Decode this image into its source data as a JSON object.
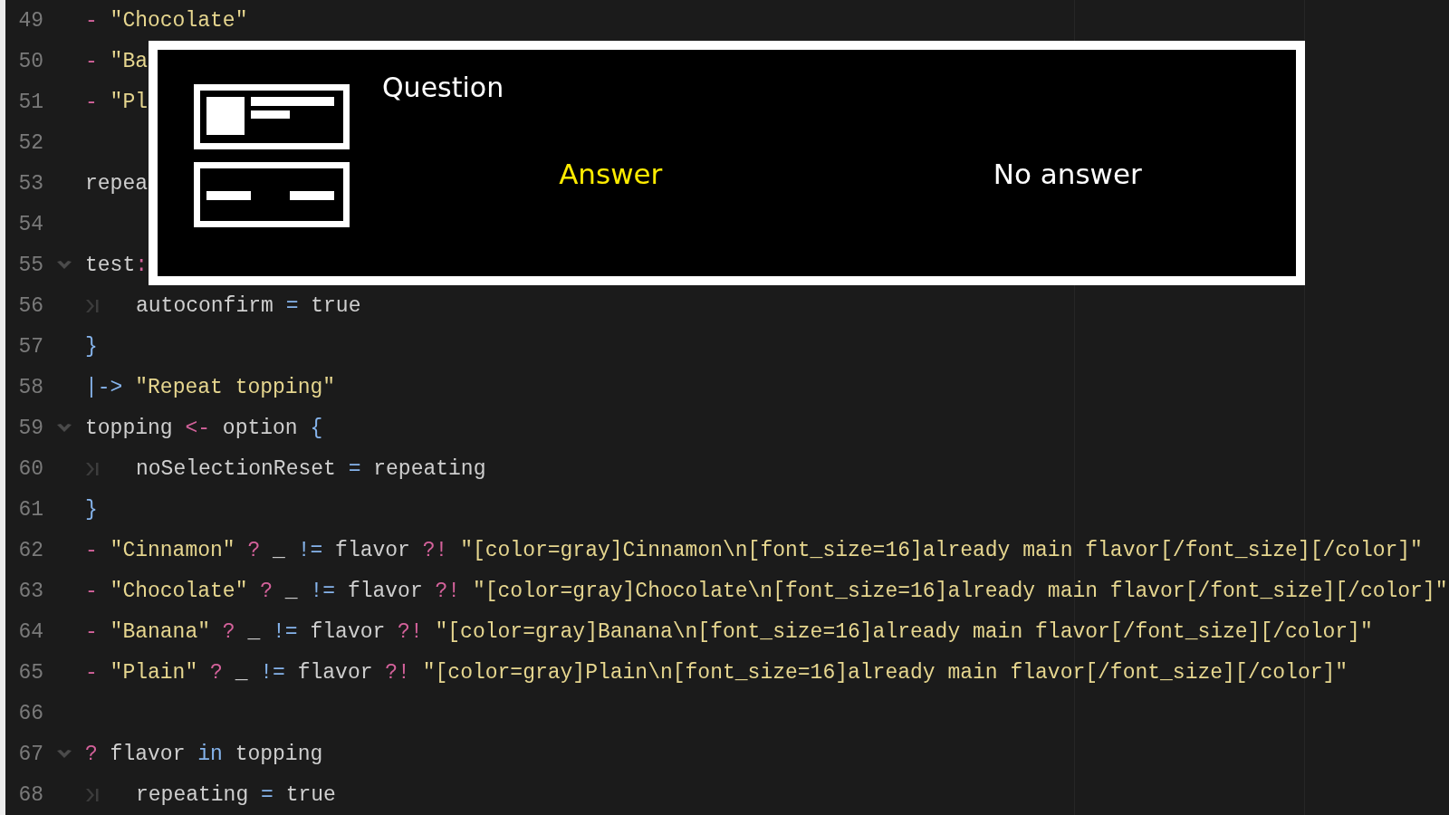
{
  "editor": {
    "lines": [
      {
        "number": "49",
        "foldable": false,
        "indent_guide": false,
        "tokens": [
          {
            "kind": "op",
            "text": "- "
          },
          {
            "kind": "str",
            "text": "\"Chocolate\""
          }
        ]
      },
      {
        "number": "50",
        "foldable": false,
        "indent_guide": false,
        "tokens": [
          {
            "kind": "op",
            "text": "- "
          },
          {
            "kind": "str",
            "text": "\"Ba"
          }
        ]
      },
      {
        "number": "51",
        "foldable": false,
        "indent_guide": false,
        "tokens": [
          {
            "kind": "op",
            "text": "- "
          },
          {
            "kind": "str",
            "text": "\"Pl"
          }
        ]
      },
      {
        "number": "52",
        "foldable": false,
        "indent_guide": false
      },
      {
        "number": "53",
        "foldable": false,
        "indent_guide": false,
        "tokens": [
          {
            "kind": "plain",
            "text": "repea"
          }
        ]
      },
      {
        "number": "54",
        "foldable": false,
        "indent_guide": false
      },
      {
        "number": "55",
        "foldable": true,
        "indent_guide": false,
        "tokens": [
          {
            "kind": "plain",
            "text": "test"
          },
          {
            "kind": "op",
            "text": ":"
          }
        ]
      },
      {
        "number": "56",
        "foldable": false,
        "indent_guide": true,
        "tokens": [
          {
            "kind": "plain",
            "text": "autoconfirm "
          },
          {
            "kind": "kw",
            "text": "="
          },
          {
            "kind": "plain",
            "text": " true"
          }
        ]
      },
      {
        "number": "57",
        "foldable": false,
        "indent_guide": false,
        "tokens": [
          {
            "kind": "kw",
            "text": "}"
          }
        ]
      },
      {
        "number": "58",
        "foldable": false,
        "indent_guide": false,
        "tokens": [
          {
            "kind": "kw",
            "text": "|-> "
          },
          {
            "kind": "str",
            "text": "\"Repeat topping\""
          }
        ]
      },
      {
        "number": "59",
        "foldable": true,
        "indent_guide": false,
        "tokens": [
          {
            "kind": "plain",
            "text": "topping "
          },
          {
            "kind": "op",
            "text": "<-"
          },
          {
            "kind": "plain",
            "text": " option "
          },
          {
            "kind": "kw",
            "text": "{"
          }
        ]
      },
      {
        "number": "60",
        "foldable": false,
        "indent_guide": true,
        "tokens": [
          {
            "kind": "plain",
            "text": "noSelectionReset "
          },
          {
            "kind": "kw",
            "text": "="
          },
          {
            "kind": "plain",
            "text": " repeating"
          }
        ]
      },
      {
        "number": "61",
        "foldable": false,
        "indent_guide": false,
        "tokens": [
          {
            "kind": "kw",
            "text": "}"
          }
        ]
      },
      {
        "number": "62",
        "foldable": false,
        "indent_guide": false,
        "tokens": [
          {
            "kind": "op",
            "text": "- "
          },
          {
            "kind": "str",
            "text": "\"Cinnamon\""
          },
          {
            "kind": "op",
            "text": " ? "
          },
          {
            "kind": "plain",
            "text": "_ "
          },
          {
            "kind": "kw",
            "text": "!="
          },
          {
            "kind": "plain",
            "text": " flavor "
          },
          {
            "kind": "op",
            "text": "?! "
          },
          {
            "kind": "str",
            "text": "\"[color=gray]Cinnamon\\n[font_size=16]already main flavor[/font_size][/color]\""
          }
        ]
      },
      {
        "number": "63",
        "foldable": false,
        "indent_guide": false,
        "tokens": [
          {
            "kind": "op",
            "text": "- "
          },
          {
            "kind": "str",
            "text": "\"Chocolate\""
          },
          {
            "kind": "op",
            "text": " ? "
          },
          {
            "kind": "plain",
            "text": "_ "
          },
          {
            "kind": "kw",
            "text": "!="
          },
          {
            "kind": "plain",
            "text": " flavor "
          },
          {
            "kind": "op",
            "text": "?! "
          },
          {
            "kind": "str",
            "text": "\"[color=gray]Chocolate\\n[font_size=16]already main flavor[/font_size][/color]\""
          }
        ]
      },
      {
        "number": "64",
        "foldable": false,
        "indent_guide": false,
        "tokens": [
          {
            "kind": "op",
            "text": "- "
          },
          {
            "kind": "str",
            "text": "\"Banana\""
          },
          {
            "kind": "op",
            "text": " ? "
          },
          {
            "kind": "plain",
            "text": "_ "
          },
          {
            "kind": "kw",
            "text": "!="
          },
          {
            "kind": "plain",
            "text": " flavor "
          },
          {
            "kind": "op",
            "text": "?! "
          },
          {
            "kind": "str",
            "text": "\"[color=gray]Banana\\n[font_size=16]already main flavor[/font_size][/color]\""
          }
        ]
      },
      {
        "number": "65",
        "foldable": false,
        "indent_guide": false,
        "tokens": [
          {
            "kind": "op",
            "text": "- "
          },
          {
            "kind": "str",
            "text": "\"Plain\""
          },
          {
            "kind": "op",
            "text": " ? "
          },
          {
            "kind": "plain",
            "text": "_ "
          },
          {
            "kind": "kw",
            "text": "!="
          },
          {
            "kind": "plain",
            "text": " flavor "
          },
          {
            "kind": "op",
            "text": "?! "
          },
          {
            "kind": "str",
            "text": "\"[color=gray]Plain\\n[font_size=16]already main flavor[/font_size][/color]\""
          }
        ]
      },
      {
        "number": "66",
        "foldable": false,
        "indent_guide": false
      },
      {
        "number": "67",
        "foldable": true,
        "indent_guide": false,
        "tokens": [
          {
            "kind": "op",
            "text": "?"
          },
          {
            "kind": "plain",
            "text": " flavor "
          },
          {
            "kind": "kw",
            "text": "in"
          },
          {
            "kind": "plain",
            "text": " topping"
          }
        ]
      },
      {
        "number": "68",
        "foldable": false,
        "indent_guide": true,
        "tokens": [
          {
            "kind": "plain",
            "text": "repeating "
          },
          {
            "kind": "kw",
            "text": "="
          },
          {
            "kind": "plain",
            "text": " true"
          }
        ]
      }
    ]
  },
  "dialog": {
    "title": "Question",
    "options": [
      {
        "label": "Answer",
        "selected": true
      },
      {
        "label": "No answer",
        "selected": false
      }
    ]
  }
}
